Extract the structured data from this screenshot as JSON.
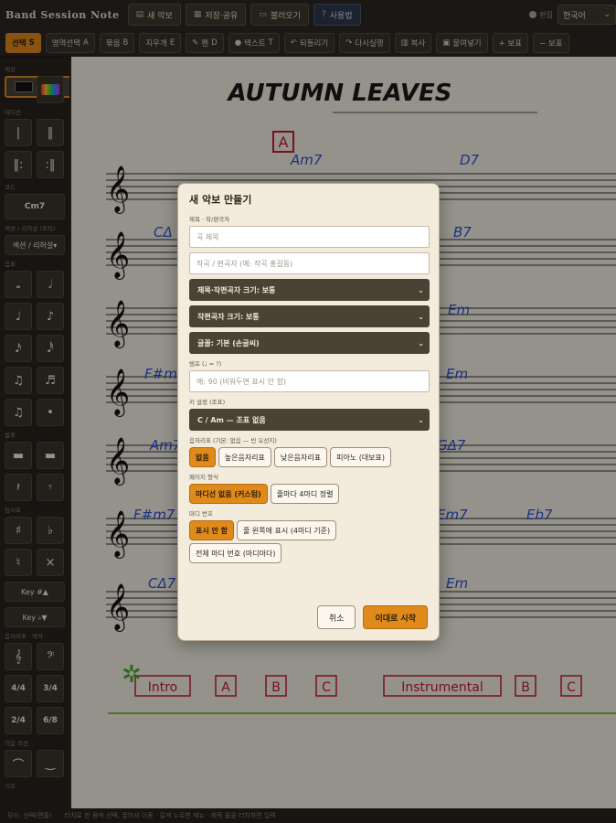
{
  "app": {
    "title": "Band Session Note"
  },
  "topbar": {
    "new_score": "새 악보",
    "save_share": "저장·공유",
    "load": "불러오기",
    "manual": "사용법",
    "edit_toggle": "편집",
    "language": "한국어"
  },
  "toolbar": {
    "select": "선택",
    "select_key": "S",
    "range_select": "영역선택",
    "range_key": "A",
    "bundle": "묶음",
    "bundle_key": "B",
    "eraser": "지우개",
    "eraser_key": "E",
    "pen": "펜",
    "pen_key": "D",
    "text": "텍스트",
    "text_key": "T",
    "undo": "되돌리기",
    "redo": "다시실행",
    "copy": "복사",
    "paste": "붙여넣기",
    "add_staff": "+ 보표",
    "remove_staff": "− 보표"
  },
  "sidebar": {
    "color_label": "색상",
    "barline_label": "마디선",
    "chord_label": "코드",
    "chord_value": "Cm7",
    "section_label": "섹션 / 리허설 (조직)",
    "section_value": "섹션 / 리허설",
    "note_label": "음표",
    "rest_label": "쉼표",
    "accidental_label": "임시표",
    "key_up": "Key #▲",
    "key_down": "Key ♭▼",
    "clef_label": "음자리표 · 박자",
    "time_44": "4/4",
    "time_34": "3/4",
    "time_24": "2/4",
    "time_68": "6/8",
    "slur_label": "이음 곡선",
    "extra_label": "기호"
  },
  "score": {
    "title": "AUTUMN LEAVES",
    "rehearsal_mark": "A",
    "chords_row1": [
      "Am7",
      "D7"
    ],
    "chords_row2": [
      "CΔ",
      "B7"
    ],
    "chords_row3": [
      "Em"
    ],
    "chords_row4": [
      "F#m7",
      "Em"
    ],
    "chords_row5": [
      "Am7",
      "GΔ7"
    ],
    "chords_row6": [
      "F#m7",
      "Em7",
      "Eb7"
    ],
    "chords_row7": [
      "CΔ7",
      "Em"
    ],
    "roadmap": [
      "Intro",
      "A",
      "B",
      "C",
      "Instrumental",
      "B",
      "C"
    ]
  },
  "modal": {
    "heading": "새 악보 만들기",
    "title_section_label": "제목 · 작/편곡자",
    "title_placeholder": "곡 제목",
    "composer_placeholder": "작곡 / 편곡자 (예: 작곡 홍길동)",
    "title_size": "제목·작편곡자 크기: 보통",
    "composer_size": "작편곡자 크기: 보통",
    "font": "글꼴: 기본 (손글씨)",
    "tempo_label": "템포 (♩ = ?)",
    "tempo_placeholder": "예: 90 (비워두면 표시 안 함)",
    "key_label": "키 설정 (조표)",
    "key_value": "C / Am — 조표 없음",
    "clef_label": "음자리표 (기본: 없음 — 빈 오선지)",
    "clef_options": [
      "없음",
      "높은음자리표",
      "낮은음자리표",
      "피아노 (대보표)"
    ],
    "page_format_label": "페이지 형식",
    "page_format_options": [
      "마디선 없음 (커스텀)",
      "줄마다 4마디 정렬"
    ],
    "measure_number_label": "마디 번호",
    "measure_number_options": [
      "표시 안 함",
      "줄 왼쪽에 표시 (4마디 기준)",
      "전체 마디 번호 (마디마다)"
    ],
    "cancel": "취소",
    "start": "이대로 시작"
  },
  "status": {
    "mode": "모드: 선택(편줄)",
    "hint": "터치로 한 음씩 선택, 끌어서 이동 · 길게 누르면 메뉴 · 제목 줄을 터치하면 입력"
  },
  "colors": {
    "accent": "#e08a1c",
    "chord_blue": "#2a52d6",
    "mark_red": "#c41a2e"
  }
}
